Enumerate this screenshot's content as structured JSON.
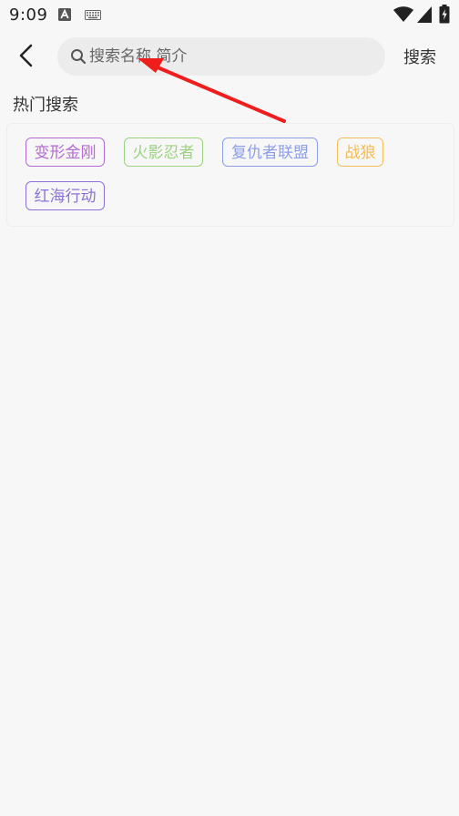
{
  "status_bar": {
    "time": "9:09",
    "a_icon": "a-notification-icon",
    "keyboard_icon": "keyboard-icon",
    "wifi_icon": "wifi-icon",
    "signal_icon": "signal-icon",
    "battery_icon": "battery-charging-icon"
  },
  "top_bar": {
    "back_icon": "back-arrow-icon",
    "search_placeholder": "搜索名称 简介",
    "search_value": "",
    "search_icon": "search-icon",
    "search_button_label": "搜索"
  },
  "hot_search": {
    "title": "热门搜索",
    "tags": [
      {
        "label": "变形金刚",
        "color": "#b46ad0"
      },
      {
        "label": "火影忍者",
        "color": "#9bd280"
      },
      {
        "label": "复仇者联盟",
        "color": "#8c9ee8"
      },
      {
        "label": "战狼",
        "color": "#f3bd5a"
      },
      {
        "label": "红海行动",
        "color": "#8c72d6"
      }
    ]
  },
  "annotation": {
    "arrow_color": "#f01d1d"
  }
}
